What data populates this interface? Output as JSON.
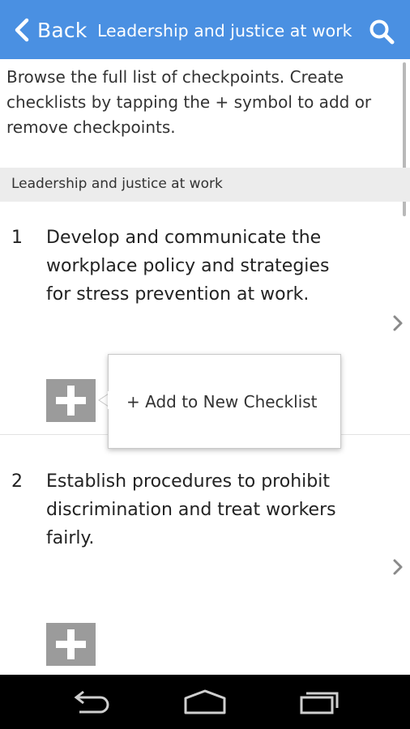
{
  "header": {
    "back_label": "Back",
    "title": "Leadership and justice at work",
    "background_color": "#4a90e2"
  },
  "intro_text": "Browse the full list of checkpoints. Create checklists by tapping the + symbol to add or remove checkpoints.",
  "section": {
    "title": "Leadership and justice at work"
  },
  "items": [
    {
      "number": "1",
      "text": "Develop and communicate the workplace policy and strategies for stress prevention at work."
    },
    {
      "number": "2",
      "text": "Establish procedures to prohibit discrimination and treat workers fairly."
    }
  ],
  "popup": {
    "add_new_label": "+ Add to New Checklist"
  },
  "icons": {
    "back": "chevron-left-icon",
    "search": "search-icon",
    "add": "plus-icon",
    "item_detail": "chevron-right-icon",
    "nav_back": "back-arrow-icon",
    "nav_home": "home-icon",
    "nav_recents": "recent-apps-icon"
  }
}
